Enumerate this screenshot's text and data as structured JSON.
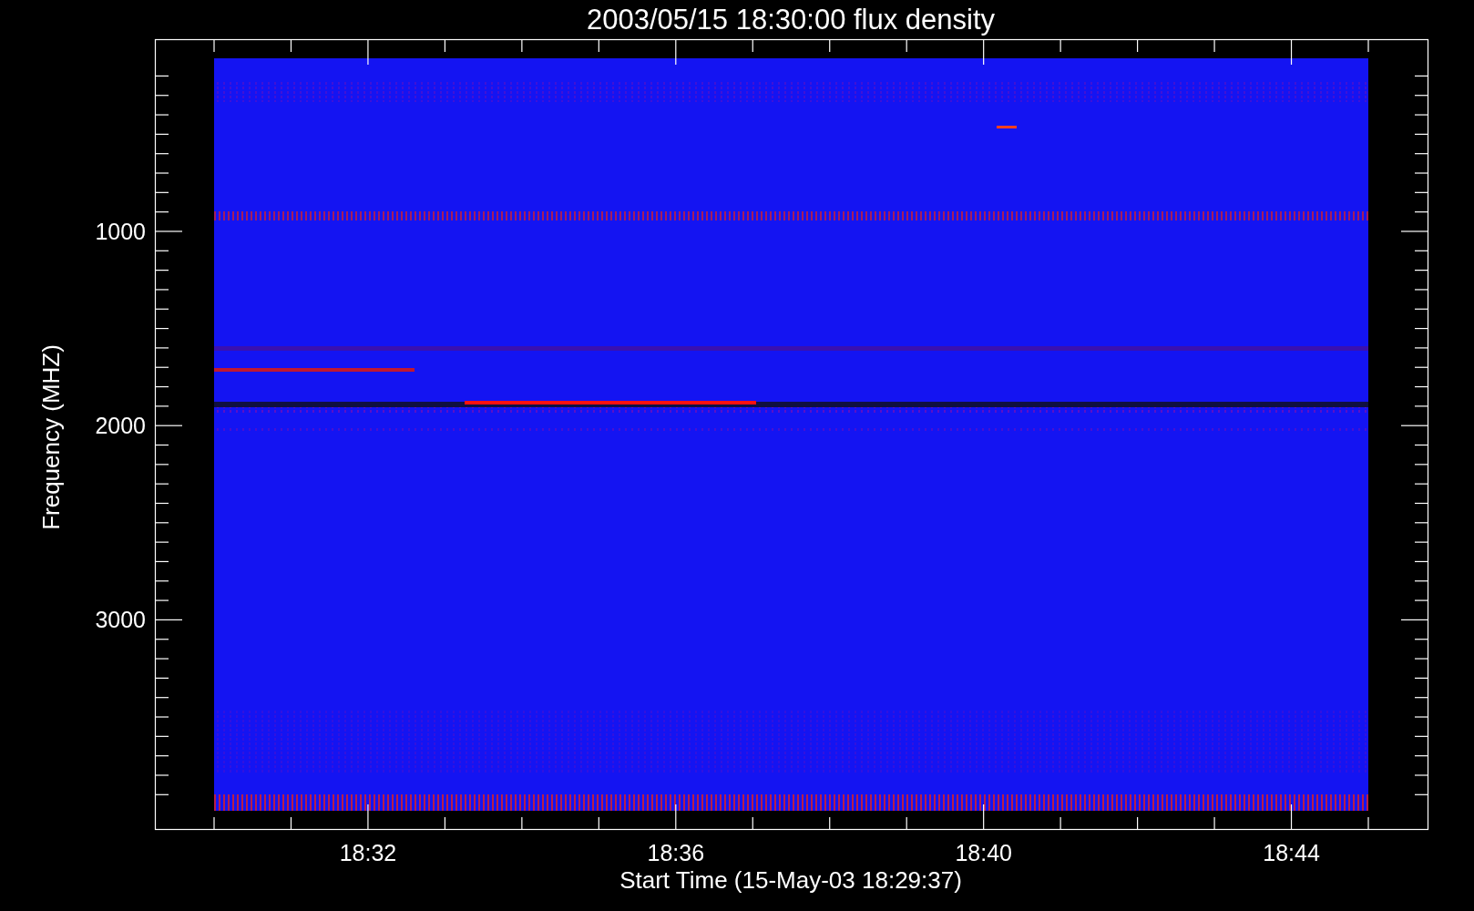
{
  "title": "2003/05/15 18:30:00 flux density",
  "ylabel": "Frequency (MHZ)",
  "xlabel": "Start Time (15-May-03 18:29:37)",
  "yticks": [
    "1000",
    "2000",
    "3000"
  ],
  "xticks": [
    "18:32",
    "18:36",
    "18:40",
    "18:44"
  ]
}
